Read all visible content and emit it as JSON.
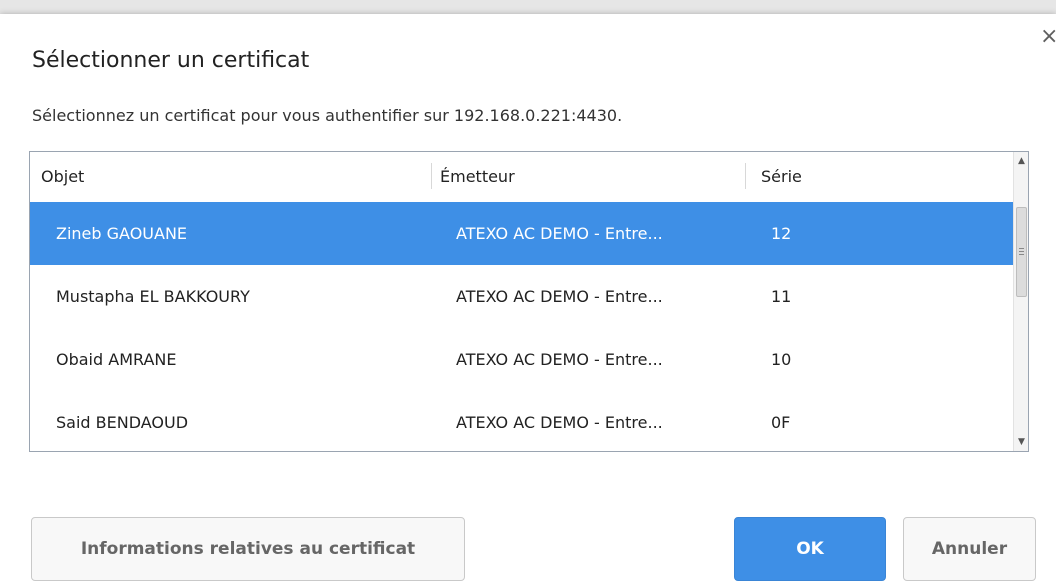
{
  "dialog": {
    "close_symbol": "×",
    "title": "Sélectionner un certificat",
    "subtitle": "Sélectionnez un certificat pour vous authentifier sur 192.168.0.221:4430."
  },
  "table": {
    "columns": [
      "Objet",
      "Émetteur",
      "Série"
    ],
    "rows": [
      {
        "objet": "Zineb GAOUANE",
        "emetteur": "ATEXO AC DEMO - Entre...",
        "serie": "12",
        "selected": true
      },
      {
        "objet": "Mustapha EL BAKKOURY",
        "emetteur": "ATEXO AC DEMO - Entre...",
        "serie": "11",
        "selected": false
      },
      {
        "objet": "Obaid AMRANE",
        "emetteur": "ATEXO AC DEMO - Entre...",
        "serie": "10",
        "selected": false
      },
      {
        "objet": "Said BENDAOUD",
        "emetteur": "ATEXO AC DEMO - Entre...",
        "serie": "0F",
        "selected": false
      }
    ],
    "scroll_up_symbol": "▲",
    "scroll_down_symbol": "▼"
  },
  "buttons": {
    "info": "Informations relatives au certificat",
    "ok": "OK",
    "cancel": "Annuler"
  },
  "colors": {
    "accent": "#3e8fe6",
    "border": "#9aa4b1"
  }
}
